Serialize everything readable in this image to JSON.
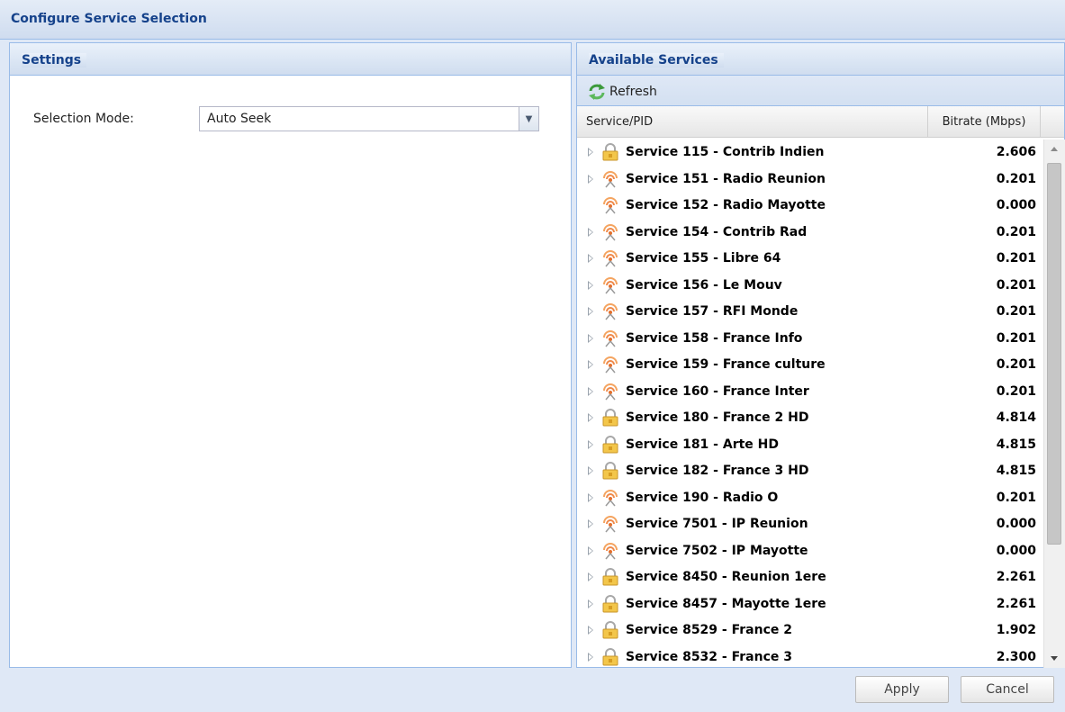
{
  "window": {
    "title": "Configure Service Selection"
  },
  "settings": {
    "title": "Settings",
    "selection_mode_label": "Selection Mode:",
    "selection_mode_value": "Auto Seek"
  },
  "available": {
    "title": "Available Services",
    "refresh_label": "Refresh",
    "columns": {
      "service": "Service/PID",
      "bitrate": "Bitrate (Mbps)"
    },
    "rows": [
      {
        "name": "Service 115 - Contrib Indien",
        "bitrate": "2.606",
        "icon": "lock-icon",
        "expandable": true
      },
      {
        "name": "Service 151 - Radio Reunion",
        "bitrate": "0.201",
        "icon": "radio-icon",
        "expandable": true
      },
      {
        "name": "Service 152 - Radio Mayotte",
        "bitrate": "0.000",
        "icon": "radio-icon",
        "expandable": false
      },
      {
        "name": "Service 154 - Contrib Rad",
        "bitrate": "0.201",
        "icon": "radio-icon",
        "expandable": true
      },
      {
        "name": "Service 155 - Libre 64",
        "bitrate": "0.201",
        "icon": "radio-icon",
        "expandable": true
      },
      {
        "name": "Service 156 - Le Mouv",
        "bitrate": "0.201",
        "icon": "radio-icon",
        "expandable": true
      },
      {
        "name": "Service 157 - RFI Monde",
        "bitrate": "0.201",
        "icon": "radio-icon",
        "expandable": true
      },
      {
        "name": "Service 158 - France Info",
        "bitrate": "0.201",
        "icon": "radio-icon",
        "expandable": true
      },
      {
        "name": "Service 159 - France culture",
        "bitrate": "0.201",
        "icon": "radio-icon",
        "expandable": true
      },
      {
        "name": "Service 160 - France Inter",
        "bitrate": "0.201",
        "icon": "radio-icon",
        "expandable": true
      },
      {
        "name": "Service 180 - France 2 HD",
        "bitrate": "4.814",
        "icon": "lock-icon",
        "expandable": true
      },
      {
        "name": "Service 181 - Arte HD",
        "bitrate": "4.815",
        "icon": "lock-icon",
        "expandable": true
      },
      {
        "name": "Service 182 - France 3 HD",
        "bitrate": "4.815",
        "icon": "lock-icon",
        "expandable": true
      },
      {
        "name": "Service 190 - Radio O",
        "bitrate": "0.201",
        "icon": "radio-icon",
        "expandable": true
      },
      {
        "name": "Service 7501 - IP Reunion",
        "bitrate": "0.000",
        "icon": "radio-icon",
        "expandable": true
      },
      {
        "name": "Service 7502 - IP Mayotte",
        "bitrate": "0.000",
        "icon": "radio-icon",
        "expandable": true
      },
      {
        "name": "Service 8450 - Reunion 1ere",
        "bitrate": "2.261",
        "icon": "lock-icon",
        "expandable": true
      },
      {
        "name": "Service 8457 - Mayotte 1ere",
        "bitrate": "2.261",
        "icon": "lock-icon",
        "expandable": true
      },
      {
        "name": "Service 8529 - France 2",
        "bitrate": "1.902",
        "icon": "lock-icon",
        "expandable": true
      },
      {
        "name": "Service 8532 - France 3",
        "bitrate": "2.300",
        "icon": "lock-icon",
        "expandable": true
      }
    ]
  },
  "buttons": {
    "apply": "Apply",
    "cancel": "Cancel"
  },
  "colors": {
    "header_text": "#15428b",
    "border": "#99bbe8",
    "background": "#dfe8f6"
  }
}
